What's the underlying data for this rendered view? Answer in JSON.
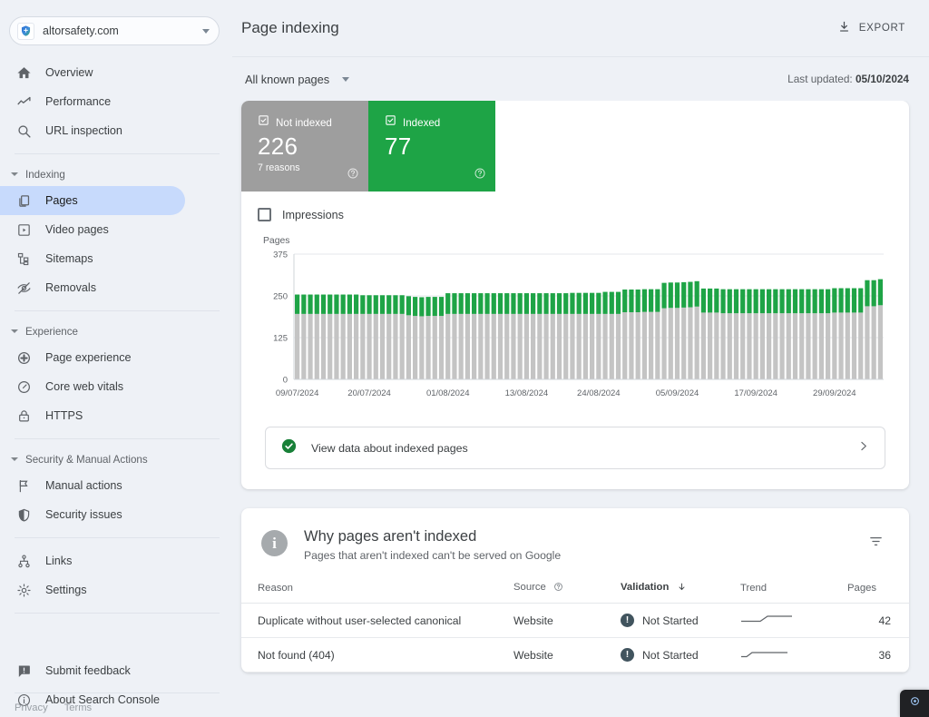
{
  "sidebar": {
    "site_selector": {
      "name": "altorsafety.com",
      "icon": "shield-favicon",
      "caret": "chevron-down-icon"
    },
    "nav_top": [
      {
        "label": "Overview",
        "icon": "home-icon",
        "active": false
      },
      {
        "label": "Performance",
        "icon": "trending-up-icon",
        "active": false
      },
      {
        "label": "URL inspection",
        "icon": "search-icon",
        "active": false
      }
    ],
    "groups": [
      {
        "title": "Indexing",
        "items": [
          {
            "label": "Pages",
            "icon": "pages-copy-icon",
            "active": true
          },
          {
            "label": "Video pages",
            "icon": "video-page-icon",
            "active": false
          },
          {
            "label": "Sitemaps",
            "icon": "sitemap-icon",
            "active": false
          },
          {
            "label": "Removals",
            "icon": "eye-off-icon",
            "active": false
          }
        ]
      },
      {
        "title": "Experience",
        "items": [
          {
            "label": "Page experience",
            "icon": "page-experience-icon",
            "active": false
          },
          {
            "label": "Core web vitals",
            "icon": "speedometer-icon",
            "active": false
          },
          {
            "label": "HTTPS",
            "icon": "lock-icon",
            "active": false
          }
        ]
      },
      {
        "title": "Security & Manual Actions",
        "items": [
          {
            "label": "Manual actions",
            "icon": "flag-icon",
            "active": false
          },
          {
            "label": "Security issues",
            "icon": "shield-icon",
            "active": false
          }
        ]
      }
    ],
    "nav_bottom": [
      {
        "label": "Links",
        "icon": "links-hierarchy-icon",
        "active": false
      },
      {
        "label": "Settings",
        "icon": "gear-icon",
        "active": false
      }
    ],
    "nav_utility": [
      {
        "label": "Submit feedback",
        "icon": "feedback-icon",
        "active": false
      },
      {
        "label": "About Search Console",
        "icon": "info-icon",
        "active": false
      }
    ],
    "footer_links": [
      "Privacy",
      "Terms"
    ]
  },
  "header": {
    "title": "Page indexing",
    "export_label": "EXPORT",
    "export_icon": "download-icon"
  },
  "subbar": {
    "filter_label": "All known pages",
    "filter_caret": "chevron-down-icon",
    "last_updated_prefix": "Last updated: ",
    "last_updated_date": "05/10/2024"
  },
  "summary": {
    "tiles": [
      {
        "label": "Not indexed",
        "value": "226",
        "sub": "7 reasons",
        "icon": "checkbox-checked-icon",
        "help_icon": "help-circle-icon",
        "color": "#9e9e9e"
      },
      {
        "label": "Indexed",
        "value": "77",
        "sub": "",
        "icon": "checkbox-checked-icon",
        "help_icon": "help-circle-icon",
        "color": "#1ea446"
      }
    ],
    "impressions_label": "Impressions",
    "impressions_checked": false
  },
  "chart_data": {
    "type": "bar",
    "stacked": true,
    "title": "",
    "ylabel": "Pages",
    "xlabel": "",
    "ylim": [
      0,
      375
    ],
    "yticks": [
      0,
      125,
      250,
      375
    ],
    "grid": true,
    "legend_position": "none",
    "xtick_labels": [
      "09/07/2024",
      "20/07/2024",
      "01/08/2024",
      "13/08/2024",
      "24/08/2024",
      "05/09/2024",
      "17/09/2024",
      "29/09/2024"
    ],
    "xtick_indices": [
      0,
      11,
      23,
      35,
      46,
      58,
      70,
      82
    ],
    "series": [
      {
        "name": "Not indexed",
        "color": "#c4c4c4",
        "values": [
          196,
          196,
          196,
          196,
          196,
          196,
          196,
          196,
          196,
          196,
          196,
          196,
          196,
          196,
          196,
          196,
          196,
          192,
          190,
          189,
          190,
          190,
          190,
          196,
          196,
          196,
          196,
          196,
          196,
          196,
          196,
          196,
          196,
          196,
          196,
          196,
          196,
          196,
          196,
          196,
          196,
          196,
          196,
          196,
          196,
          196,
          196,
          196,
          196,
          196,
          201,
          201,
          201,
          202,
          202,
          202,
          213,
          214,
          214,
          215,
          216,
          218,
          200,
          200,
          200,
          198,
          198,
          198,
          198,
          198,
          198,
          198,
          198,
          198,
          198,
          198,
          198,
          198,
          198,
          198,
          198,
          198,
          200,
          200,
          200,
          200,
          200,
          219,
          219,
          222
        ]
      },
      {
        "name": "Indexed",
        "color": "#1ea446",
        "values": [
          58,
          58,
          58,
          58,
          58,
          58,
          58,
          58,
          58,
          58,
          56,
          56,
          56,
          56,
          56,
          56,
          56,
          57,
          57,
          57,
          57,
          57,
          57,
          62,
          62,
          62,
          62,
          62,
          62,
          62,
          62,
          62,
          62,
          62,
          62,
          62,
          62,
          62,
          62,
          62,
          62,
          62,
          63,
          63,
          63,
          63,
          63,
          66,
          66,
          66,
          68,
          68,
          68,
          68,
          68,
          68,
          76,
          76,
          76,
          76,
          76,
          76,
          72,
          72,
          72,
          72,
          72,
          72,
          72,
          72,
          72,
          72,
          72,
          72,
          72,
          72,
          72,
          72,
          72,
          72,
          72,
          72,
          73,
          73,
          73,
          73,
          73,
          78,
          78,
          78
        ]
      }
    ]
  },
  "view_data_row": {
    "label": "View data about indexed pages",
    "icon": "check-circle-icon",
    "chevron": "chevron-right-icon"
  },
  "why_section": {
    "icon": "info-circle-icon",
    "title": "Why pages aren't indexed",
    "subtitle": "Pages that aren't indexed can't be served on Google",
    "filter_icon": "filter-list-icon",
    "columns": [
      {
        "label": "Reason",
        "sorted": false
      },
      {
        "label": "Source",
        "sorted": false,
        "help_icon": "help-circle-icon"
      },
      {
        "label": "Validation",
        "sorted": true,
        "sort_icon": "arrow-down-icon"
      },
      {
        "label": "Trend",
        "sorted": false
      },
      {
        "label": "Pages",
        "sorted": false
      }
    ],
    "rows": [
      {
        "reason": "Duplicate without user-selected canonical",
        "source": "Website",
        "validation": "Not Started",
        "validation_icon": "alert-circle-icon",
        "trend": "rising-mid",
        "pages": "42"
      },
      {
        "reason": "Not found (404)",
        "source": "Website",
        "validation": "Not Started",
        "validation_icon": "alert-circle-icon",
        "trend": "rising-early",
        "pages": "36"
      }
    ]
  },
  "corner_widget": {
    "icon": "assistant-icon"
  }
}
